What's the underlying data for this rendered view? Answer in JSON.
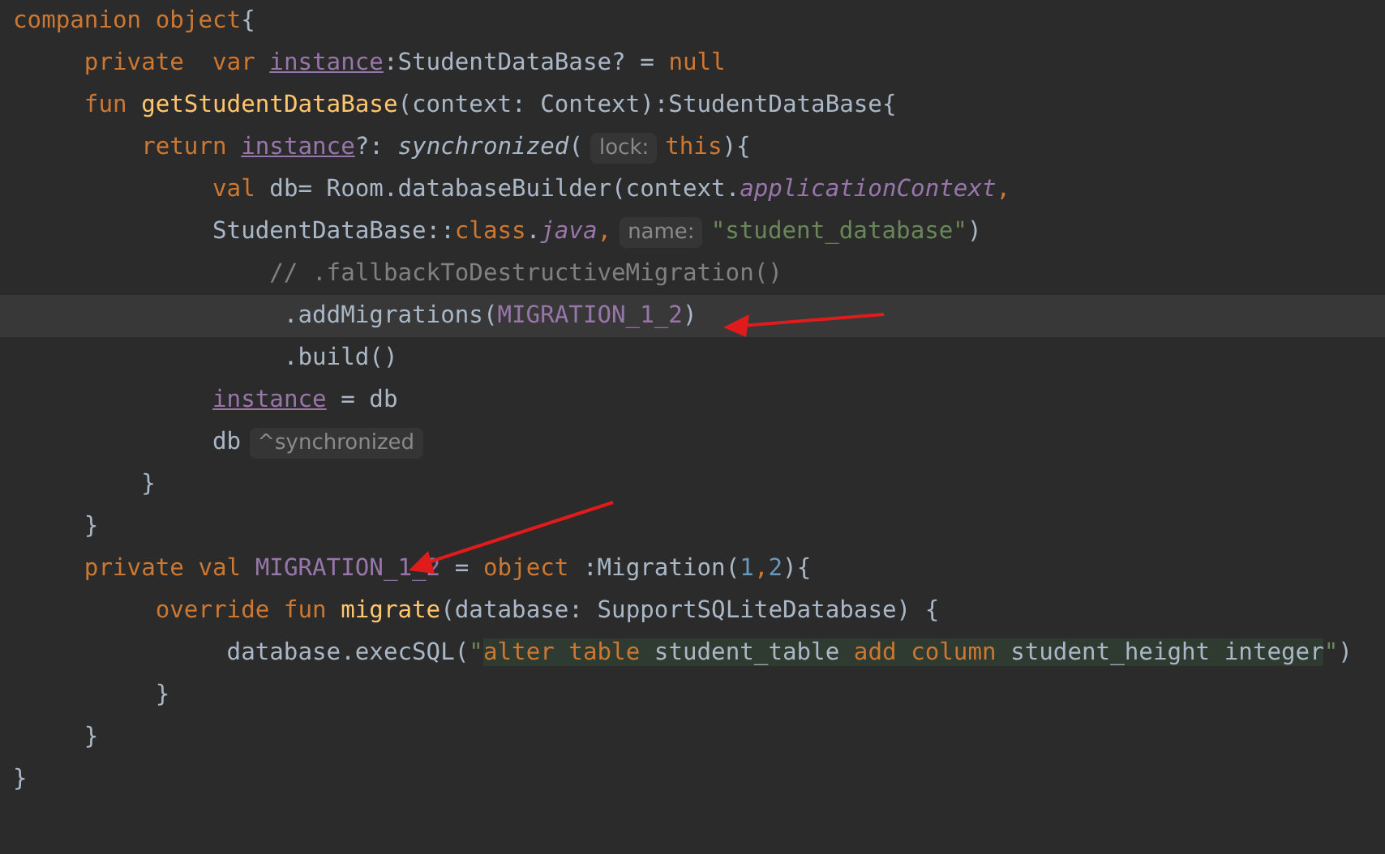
{
  "editor": {
    "lines": [
      {
        "current": false,
        "segments": [
          {
            "text": "companion object",
            "kind": "keyword"
          },
          {
            "text": "{",
            "kind": "plain"
          }
        ]
      },
      {
        "current": false,
        "segments": [
          {
            "text": "     private  var ",
            "kind": "keyword"
          },
          {
            "text": "instance",
            "kind": "field_underline"
          },
          {
            "text": ":StudentDataBase? = ",
            "kind": "plain"
          },
          {
            "text": "null",
            "kind": "keyword"
          }
        ]
      },
      {
        "current": false,
        "segments": [
          {
            "text": "     fun ",
            "kind": "keyword"
          },
          {
            "text": "getStudentDataBase",
            "kind": "function"
          },
          {
            "text": "(context: Context):StudentDataBase{",
            "kind": "plain"
          }
        ]
      },
      {
        "current": false,
        "segments": [
          {
            "text": "         return ",
            "kind": "keyword"
          },
          {
            "text": "instance",
            "kind": "field_underline"
          },
          {
            "text": "?: ",
            "kind": "plain"
          },
          {
            "text": "synchronized",
            "kind": "italic"
          },
          {
            "text": "(",
            "kind": "plain"
          },
          {
            "text": "lock:",
            "kind": "hint"
          },
          {
            "text": "this",
            "kind": "keyword"
          },
          {
            "text": "){",
            "kind": "plain"
          }
        ]
      },
      {
        "current": false,
        "segments": [
          {
            "text": "              val ",
            "kind": "keyword"
          },
          {
            "text": "db= Room.databaseBuilder(context.",
            "kind": "plain"
          },
          {
            "text": "applicationContext",
            "kind": "italic_field"
          },
          {
            "text": ",",
            "kind": "keyword"
          }
        ]
      },
      {
        "current": false,
        "segments": [
          {
            "text": "              StudentDataBase::",
            "kind": "plain"
          },
          {
            "text": "class",
            "kind": "keyword"
          },
          {
            "text": ".",
            "kind": "plain"
          },
          {
            "text": "java",
            "kind": "italic_field"
          },
          {
            "text": ",",
            "kind": "keyword"
          },
          {
            "text": "name:",
            "kind": "hint"
          },
          {
            "text": "\"student_database\"",
            "kind": "string"
          },
          {
            "text": ")",
            "kind": "plain"
          }
        ]
      },
      {
        "current": false,
        "segments": [
          {
            "text": "                  // .fallbackToDestructiveMigration()",
            "kind": "comment"
          }
        ]
      },
      {
        "current": true,
        "segments": [
          {
            "text": "                   .addMigrations(",
            "kind": "plain"
          },
          {
            "text": "MIGRATION_1_2",
            "kind": "field"
          },
          {
            "text": ")",
            "kind": "plain"
          }
        ]
      },
      {
        "current": false,
        "segments": [
          {
            "text": "                   .build()",
            "kind": "plain"
          }
        ]
      },
      {
        "current": false,
        "segments": [
          {
            "text": "              instance",
            "kind": "field_underline"
          },
          {
            "text": " = db",
            "kind": "plain"
          }
        ]
      },
      {
        "current": false,
        "segments": [
          {
            "text": "              db",
            "kind": "plain"
          },
          {
            "text": "^synchronized",
            "kind": "hint"
          }
        ]
      },
      {
        "current": false,
        "segments": [
          {
            "text": "         }",
            "kind": "plain"
          }
        ]
      },
      {
        "current": false,
        "segments": [
          {
            "text": "     }",
            "kind": "plain"
          }
        ]
      },
      {
        "current": false,
        "segments": [
          {
            "text": "     private val ",
            "kind": "keyword"
          },
          {
            "text": "MIGRATION_1_2",
            "kind": "field"
          },
          {
            "text": " = ",
            "kind": "plain"
          },
          {
            "text": "object ",
            "kind": "keyword"
          },
          {
            "text": ":Migration(",
            "kind": "plain"
          },
          {
            "text": "1",
            "kind": "number"
          },
          {
            "text": ",",
            "kind": "keyword"
          },
          {
            "text": "2",
            "kind": "number"
          },
          {
            "text": "){",
            "kind": "plain"
          }
        ]
      },
      {
        "current": false,
        "segments": [
          {
            "text": "          override fun ",
            "kind": "keyword"
          },
          {
            "text": "migrate",
            "kind": "function"
          },
          {
            "text": "(database: SupportSQLiteDatabase) {",
            "kind": "plain"
          }
        ]
      },
      {
        "current": false,
        "segments": [
          {
            "text": "               database.execSQL(",
            "kind": "plain"
          },
          {
            "text": "\"",
            "kind": "string"
          },
          {
            "text": "alter table ",
            "kind": "sql_keyword"
          },
          {
            "text": "student_table ",
            "kind": "sql_plain"
          },
          {
            "text": "add column ",
            "kind": "sql_keyword"
          },
          {
            "text": "student_height integer",
            "kind": "sql_plain"
          },
          {
            "text": "\"",
            "kind": "string"
          },
          {
            "text": ")",
            "kind": "plain"
          }
        ]
      },
      {
        "current": false,
        "segments": [
          {
            "text": "          }",
            "kind": "plain"
          }
        ]
      },
      {
        "current": false,
        "segments": [
          {
            "text": "     }",
            "kind": "plain"
          }
        ]
      },
      {
        "current": false,
        "segments": [
          {
            "text": "}",
            "kind": "plain"
          }
        ]
      }
    ]
  }
}
